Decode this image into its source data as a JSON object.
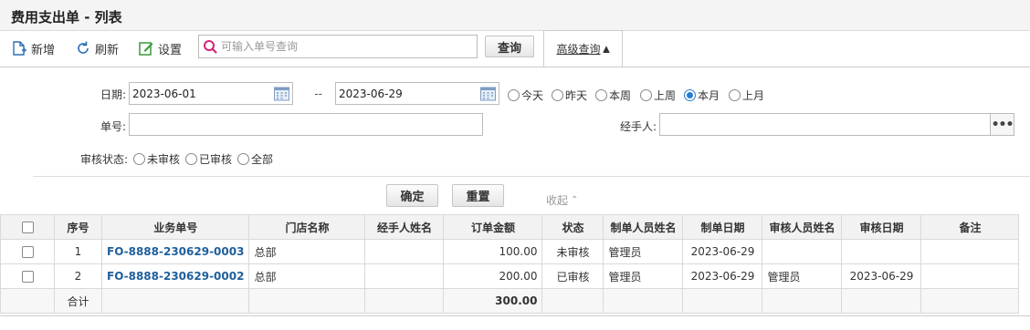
{
  "title": "费用支出单 - 列表",
  "toolbar": {
    "add_label": "新增",
    "refresh_label": "刷新",
    "settings_label": "设置",
    "search_placeholder": "可输入单号查询",
    "search_value": "",
    "query_label": "查询",
    "advanced_label": "高级查询"
  },
  "filters": {
    "date_label": "日期:",
    "date_from": "2023-06-01",
    "date_sep": "--",
    "date_to": "2023-06-29",
    "date_options": [
      {
        "label": "今天",
        "selected": false
      },
      {
        "label": "昨天",
        "selected": false
      },
      {
        "label": "本周",
        "selected": false
      },
      {
        "label": "上周",
        "selected": false
      },
      {
        "label": "本月",
        "selected": true
      },
      {
        "label": "上月",
        "selected": false
      }
    ],
    "number_label": "单号:",
    "number_value": "",
    "handler_label": "经手人:",
    "handler_value": "",
    "audit_label": "审核状态:",
    "audit_options": [
      {
        "label": "未审核",
        "selected": false
      },
      {
        "label": "已审核",
        "selected": false
      },
      {
        "label": "全部",
        "selected": false
      }
    ],
    "confirm_label": "确定",
    "reset_label": "重置",
    "collapse_label": "收起"
  },
  "table": {
    "columns": [
      "",
      "序号",
      "业务单号",
      "门店名称",
      "经手人姓名",
      "订单金额",
      "状态",
      "制单人员姓名",
      "制单日期",
      "审核人员姓名",
      "审核日期",
      "备注"
    ],
    "rows": [
      {
        "index": "1",
        "number": "FO-8888-230629-0003",
        "store": "总部",
        "handler": "",
        "amount": "100.00",
        "status": "未审核",
        "creator": "管理员",
        "created": "2023-06-29",
        "auditor": "",
        "audit_date": "",
        "note": ""
      },
      {
        "index": "2",
        "number": "FO-8888-230629-0002",
        "store": "总部",
        "handler": "",
        "amount": "200.00",
        "status": "已审核",
        "creator": "管理员",
        "created": "2023-06-29",
        "auditor": "管理员",
        "audit_date": "2023-06-29",
        "note": ""
      }
    ],
    "total_label": "合计",
    "total_amount": "300.00"
  },
  "colors": {
    "link": "#1f5f9c",
    "radio_selected": "#2a7ccf",
    "header_bg": "#f2f2f2"
  }
}
